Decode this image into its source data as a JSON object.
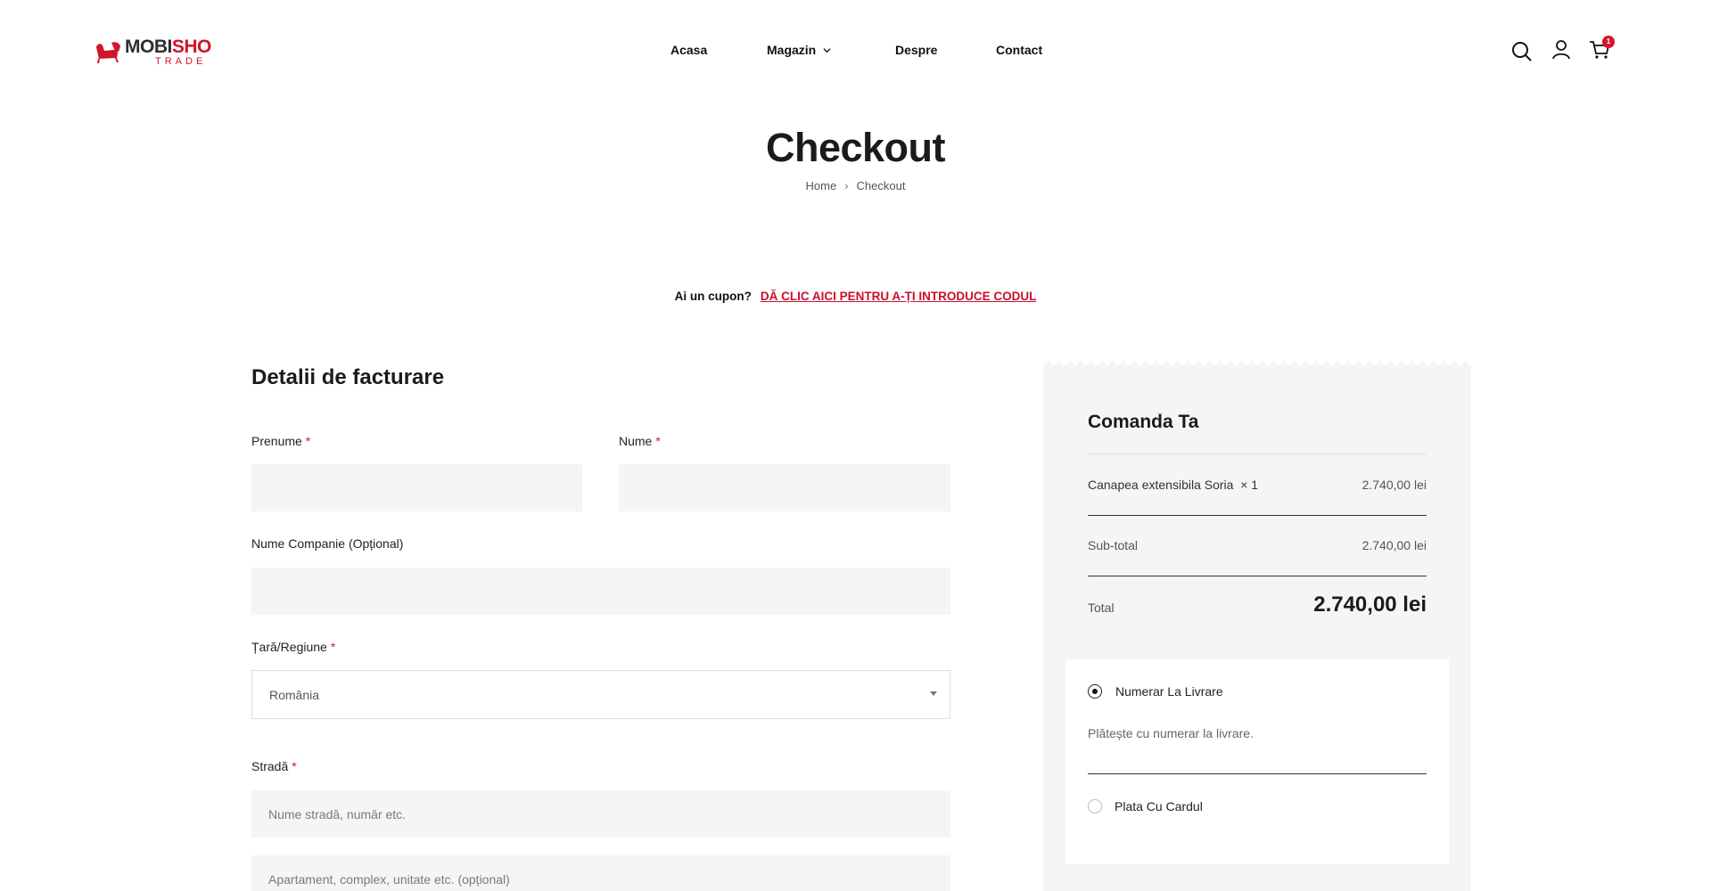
{
  "brand": {
    "logo_part1": "MOBI",
    "logo_part2": "SHO",
    "logo_sub": "TRADE",
    "accent_color": "#d2152b"
  },
  "nav": {
    "items": [
      {
        "label": "Acasa"
      },
      {
        "label": "Magazin"
      },
      {
        "label": "Despre"
      },
      {
        "label": "Contact"
      }
    ],
    "cart_count": "1"
  },
  "page": {
    "title": "Checkout",
    "breadcrumb": [
      "Home",
      "Checkout"
    ]
  },
  "coupon": {
    "question": "Ai un cupon?",
    "link": "DĂ CLIC AICI PENTRU A-ȚI INTRODUCE CODUL"
  },
  "billing": {
    "title": "Detalii de facturare",
    "first_name_label": "Prenume",
    "last_name_label": "Nume",
    "company_label": "Nume Companie (Opțional)",
    "country_label": "Țară/Regiune",
    "country_value": "România",
    "street_label": "Stradă",
    "street_placeholder": "Nume stradă, număr etc.",
    "street2_placeholder": "Apartament, complex, unitate etc. (opțional)",
    "required_mark": "*"
  },
  "order": {
    "title": "Comanda Ta",
    "item_name": "Canapea extensibila Soria",
    "item_qty": "× 1",
    "item_price": "2.740,00 lei",
    "subtotal_label": "Sub-total",
    "subtotal_value": "2.740,00 lei",
    "total_label": "Total",
    "total_value": "2.740,00 lei"
  },
  "payment": {
    "option1_label": "Numerar La Livrare",
    "option1_desc": "Plătește cu numerar la livrare.",
    "option2_label": "Plata Cu Cardul"
  }
}
